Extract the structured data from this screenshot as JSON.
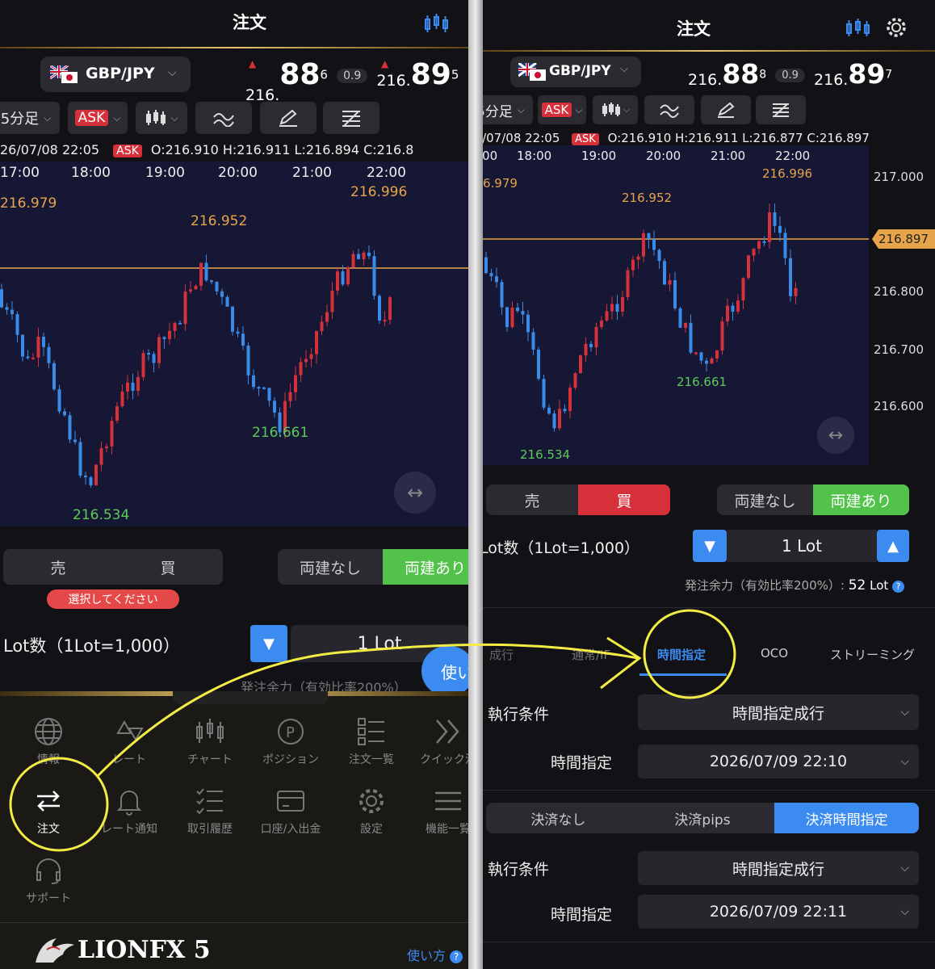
{
  "left": {
    "title": "注文",
    "pair": "GBP/JPY",
    "bid": {
      "big": "216.",
      "main": "88",
      "sup": "6"
    },
    "spread": "0.9",
    "ask": {
      "big": "216.",
      "main": "89",
      "sup": "5"
    },
    "timeframe": "5分足",
    "ask_label": "ASK",
    "ohlc_date": "26/07/08 22:05",
    "ohlc": "O:216.910 H:216.911 L:216.894 C:216.8",
    "times": [
      "17:00",
      "18:00",
      "19:00",
      "20:00",
      "21:00",
      "22:00"
    ],
    "annotations": {
      "high_left": "216.979",
      "mid": "216.952",
      "high": "216.996",
      "low": "216.534",
      "low2": "216.661"
    },
    "sell": "売",
    "buy": "買",
    "no_hedge": "両建なし",
    "hedge": "両建あり",
    "select_prompt": "選択してください",
    "lot_label": "Lot数（1Lot=1,000）",
    "lot_value": "1 Lot",
    "margin_partial": "発注余力（有効比率200%）",
    "bubble": "使い",
    "menu": [
      "情報",
      "レート",
      "チャート",
      "ポジション",
      "注文一覧",
      "クイック注"
    ],
    "menu2": [
      "注文",
      "レート通知",
      "取引履歴",
      "口座/入出金",
      "設定",
      "機能一覧"
    ],
    "support": "サポート",
    "logo": "LIONFX 5",
    "howto": "使い方"
  },
  "right": {
    "title": "注文",
    "pair": "GBP/JPY",
    "bid": {
      "big": "216.",
      "main": "88",
      "sup": "8"
    },
    "spread": "0.9",
    "ask": {
      "big": "216.",
      "main": "89",
      "sup": "7"
    },
    "timeframe": "5分足",
    "ask_label": "ASK",
    "ohlc_date": "26/07/08 22:05",
    "ohlc": "O:216.910 H:216.911 L:216.877 C:216.897",
    "times": [
      ":00",
      "18:00",
      "19:00",
      "20:00",
      "21:00",
      "22:00"
    ],
    "price_axis": [
      "217.000",
      "216.897",
      "216.800",
      "216.700",
      "216.600"
    ],
    "annotations": {
      "high_left": "6.979",
      "mid": "216.952",
      "high": "216.996",
      "low": "216.534",
      "low2": "216.661"
    },
    "sell": "売",
    "buy": "買",
    "no_hedge": "両建なし",
    "hedge": "両建あり",
    "lot_label": "Lot数（1Lot=1,000）",
    "lot_value": "1 Lot",
    "margin_label": "発注余力（有効比率200%）:",
    "margin_value": "52",
    "margin_unit": "Lot",
    "tabs": [
      "成行",
      "通常/IF",
      "時間指定",
      "OCO",
      "ストリーミング"
    ],
    "exec_label": "執行条件",
    "exec_value": "時間指定成行",
    "time_label": "時間指定",
    "time_value": "2026/07/09 22:10",
    "settle": [
      "決済なし",
      "決済pips",
      "決済時間指定"
    ],
    "exec_label2": "執行条件",
    "exec_value2": "時間指定成行",
    "time_label2": "時間指定",
    "time_value2": "2026/07/09 22:11"
  },
  "colors": {
    "up": "#d6303b",
    "down": "#3a8be8",
    "hedge_on": "#53c24a",
    "accent": "#3b8bf0",
    "gold": "#e8a44a",
    "annotation": "#f3ec45"
  }
}
